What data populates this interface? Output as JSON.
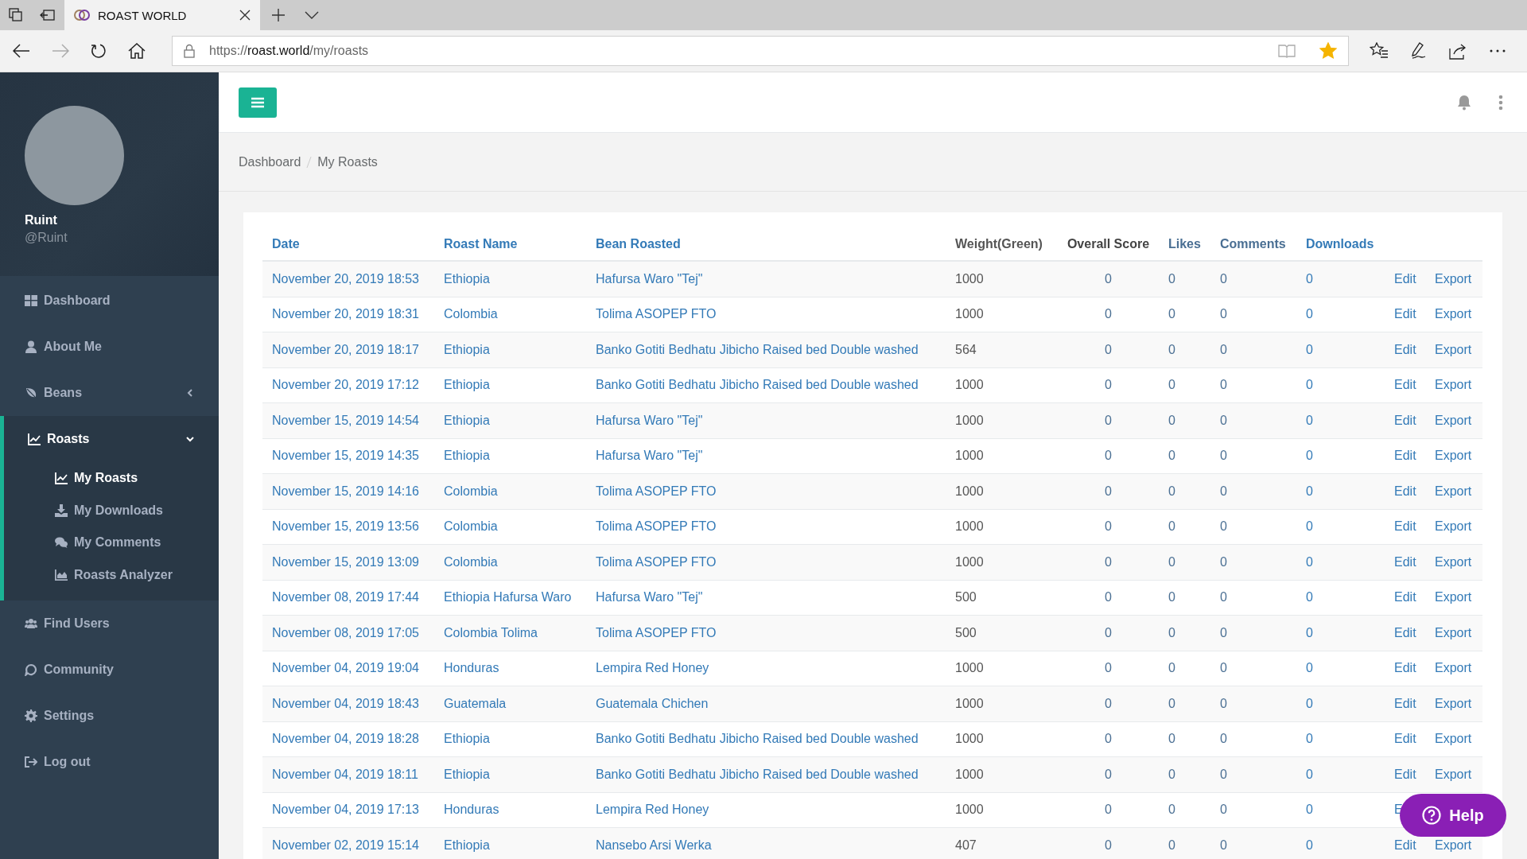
{
  "browser": {
    "tab_title": "ROAST WORLD",
    "url_scheme": "https://",
    "url_host": "roast.world",
    "url_path": "/my/roasts",
    "favorited": true
  },
  "sidebar": {
    "profile": {
      "name": "Ruint",
      "handle": "@Ruint"
    },
    "items": [
      {
        "label": "Dashboard",
        "selected": false
      },
      {
        "label": "About Me",
        "selected": false
      },
      {
        "label": "Beans",
        "selected": false,
        "expanded": false
      },
      {
        "label": "Roasts",
        "selected": true,
        "expanded": true,
        "children": [
          {
            "label": "My Roasts",
            "selected": true
          },
          {
            "label": "My Downloads",
            "selected": false
          },
          {
            "label": "My Comments",
            "selected": false
          },
          {
            "label": "Roasts Analyzer",
            "selected": false
          }
        ]
      },
      {
        "label": "Find Users",
        "selected": false
      },
      {
        "label": "Community",
        "selected": false
      },
      {
        "label": "Settings",
        "selected": false
      },
      {
        "label": "Log out",
        "selected": false
      }
    ]
  },
  "breadcrumb": [
    "Dashboard",
    "My Roasts"
  ],
  "table": {
    "columns": [
      {
        "label": "Date",
        "kind": "link"
      },
      {
        "label": "Roast Name",
        "kind": "link"
      },
      {
        "label": "Bean Roasted",
        "kind": "link"
      },
      {
        "label": "Weight(Green)",
        "kind": "text"
      },
      {
        "label": "Overall Score",
        "kind": "center"
      },
      {
        "label": "Likes",
        "kind": "num"
      },
      {
        "label": "Comments",
        "kind": "num"
      },
      {
        "label": "Downloads",
        "kind": "link"
      }
    ],
    "rows": [
      {
        "cells": [
          "November 20, 2019 18:53",
          "Ethiopia",
          "Hafursa Waro \"Tej\"",
          "1000",
          "0",
          "0",
          "0",
          "0"
        ],
        "actions": [
          "Edit",
          "Export"
        ]
      },
      {
        "cells": [
          "November 20, 2019 18:31",
          "Colombia",
          "Tolima ASOPEP FTO",
          "1000",
          "0",
          "0",
          "0",
          "0"
        ],
        "actions": [
          "Edit",
          "Export"
        ]
      },
      {
        "cells": [
          "November 20, 2019 18:17",
          "Ethiopia",
          "Banko Gotiti Bedhatu Jibicho Raised bed Double washed",
          "564",
          "0",
          "0",
          "0",
          "0"
        ],
        "actions": [
          "Edit",
          "Export"
        ]
      },
      {
        "cells": [
          "November 20, 2019 17:12",
          "Ethiopia",
          "Banko Gotiti Bedhatu Jibicho Raised bed Double washed",
          "1000",
          "0",
          "0",
          "0",
          "0"
        ],
        "actions": [
          "Edit",
          "Export"
        ]
      },
      {
        "cells": [
          "November 15, 2019 14:54",
          "Ethiopia",
          "Hafursa Waro \"Tej\"",
          "1000",
          "0",
          "0",
          "0",
          "0"
        ],
        "actions": [
          "Edit",
          "Export"
        ]
      },
      {
        "cells": [
          "November 15, 2019 14:35",
          "Ethiopia",
          "Hafursa Waro \"Tej\"",
          "1000",
          "0",
          "0",
          "0",
          "0"
        ],
        "actions": [
          "Edit",
          "Export"
        ]
      },
      {
        "cells": [
          "November 15, 2019 14:16",
          "Colombia",
          "Tolima ASOPEP FTO",
          "1000",
          "0",
          "0",
          "0",
          "0"
        ],
        "actions": [
          "Edit",
          "Export"
        ]
      },
      {
        "cells": [
          "November 15, 2019 13:56",
          "Colombia",
          "Tolima ASOPEP FTO",
          "1000",
          "0",
          "0",
          "0",
          "0"
        ],
        "actions": [
          "Edit",
          "Export"
        ]
      },
      {
        "cells": [
          "November 15, 2019 13:09",
          "Colombia",
          "Tolima ASOPEP FTO",
          "1000",
          "0",
          "0",
          "0",
          "0"
        ],
        "actions": [
          "Edit",
          "Export"
        ]
      },
      {
        "cells": [
          "November 08, 2019 17:44",
          "Ethiopia Hafursa Waro",
          "Hafursa Waro \"Tej\"",
          "500",
          "0",
          "0",
          "0",
          "0"
        ],
        "actions": [
          "Edit",
          "Export"
        ]
      },
      {
        "cells": [
          "November 08, 2019 17:05",
          "Colombia Tolima",
          "Tolima ASOPEP FTO",
          "500",
          "0",
          "0",
          "0",
          "0"
        ],
        "actions": [
          "Edit",
          "Export"
        ]
      },
      {
        "cells": [
          "November 04, 2019 19:04",
          "Honduras",
          "Lempira Red Honey",
          "1000",
          "0",
          "0",
          "0",
          "0"
        ],
        "actions": [
          "Edit",
          "Export"
        ]
      },
      {
        "cells": [
          "November 04, 2019 18:43",
          "Guatemala",
          "Guatemala Chichen",
          "1000",
          "0",
          "0",
          "0",
          "0"
        ],
        "actions": [
          "Edit",
          "Export"
        ]
      },
      {
        "cells": [
          "November 04, 2019 18:28",
          "Ethiopia",
          "Banko Gotiti Bedhatu Jibicho Raised bed Double washed",
          "1000",
          "0",
          "0",
          "0",
          "0"
        ],
        "actions": [
          "Edit",
          "Export"
        ]
      },
      {
        "cells": [
          "November 04, 2019 18:11",
          "Ethiopia",
          "Banko Gotiti Bedhatu Jibicho Raised bed Double washed",
          "1000",
          "0",
          "0",
          "0",
          "0"
        ],
        "actions": [
          "Edit",
          "Export"
        ]
      },
      {
        "cells": [
          "November 04, 2019 17:13",
          "Honduras",
          "Lempira Red Honey",
          "1000",
          "0",
          "0",
          "0",
          "0"
        ],
        "actions": [
          "E"
        ]
      },
      {
        "cells": [
          "November 02, 2019 15:14",
          "Ethiopia",
          "Nansebo Arsi Werka",
          "407",
          "0",
          "0",
          "0",
          "0"
        ],
        "actions": [
          "Edit",
          "Export"
        ]
      }
    ]
  },
  "help_button": {
    "label": "Help"
  }
}
